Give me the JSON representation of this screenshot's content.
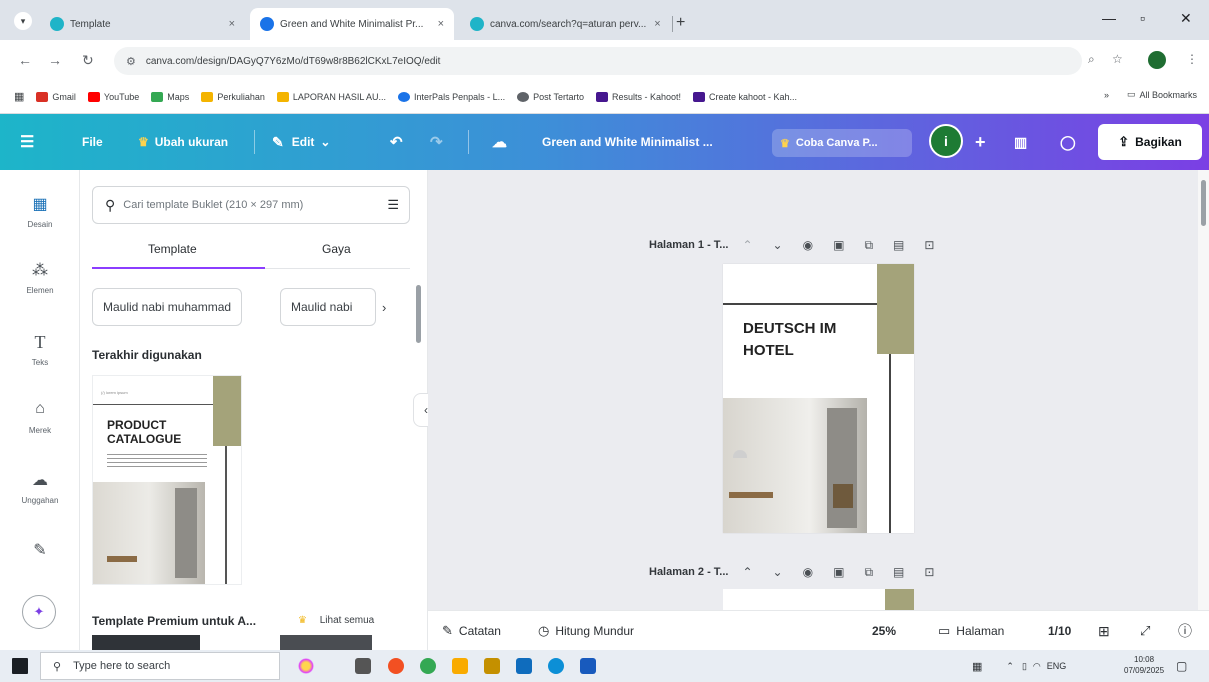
{
  "browser": {
    "tabs": [
      {
        "label": "Template",
        "close": "×"
      },
      {
        "label": "Green and White Minimalist Pr...",
        "close": "×"
      },
      {
        "label": "canva.com/search?q=aturan perv...",
        "close": "×"
      }
    ],
    "new_tab": "+",
    "address": "canva.com/design/DAGyQ7Y6zMo/dT69w8r8B62lCKxL7eIOQ/edit",
    "bookmarks": [
      {
        "label": "Gmail",
        "color": "#d93025"
      },
      {
        "label": "YouTube",
        "color": "#ff0000"
      },
      {
        "label": "Maps",
        "color": "#34a853"
      },
      {
        "label": "Perkuliahan",
        "color": "#f4b400"
      },
      {
        "label": "LAPORAN HASIL AU...",
        "color": "#f4b400"
      },
      {
        "label": "InterPals Penpals - L...",
        "color": "#1a73e8"
      },
      {
        "label": "Post Tertarto",
        "color": "#5f6368"
      },
      {
        "label": "Results - Kahoot!",
        "color": "#46178f"
      },
      {
        "label": "Create kahoot - Kah...",
        "color": "#46178f"
      }
    ],
    "bookmarks_more": "»",
    "all_bookmarks": "All Bookmarks"
  },
  "canva_header": {
    "file": "File",
    "resize": "Ubah ukuran",
    "edit": "Edit",
    "doc_title": "Green and White Minimalist ...",
    "try_pro": "Coba Canva P...",
    "avatar_initial": "i",
    "share": "Bagikan",
    "plus": "+"
  },
  "rail": [
    {
      "label": "Desain",
      "icon": "design-icon"
    },
    {
      "label": "Elemen",
      "icon": "elements-icon"
    },
    {
      "label": "Teks",
      "icon": "text-icon"
    },
    {
      "label": "Merek",
      "icon": "brand-icon"
    },
    {
      "label": "Unggahan",
      "icon": "upload-icon"
    },
    {
      "label": "",
      "icon": "draw-icon"
    }
  ],
  "panel": {
    "search_placeholder": "Cari template Buklet (210 × 297 mm)",
    "tabs": [
      "Template",
      "Gaya"
    ],
    "chips": [
      "Maulid nabi muhammad",
      "Maulid nabi"
    ],
    "recent_title": "Terakhir digunakan",
    "premium_title": "Template Premium untuk A...",
    "see_all": "Lihat semua",
    "thumb_title_line1": "PRODUCT",
    "thumb_title_line2": "CATALOGUE",
    "thumb_tiny": "(/) lorem ipsum"
  },
  "canvas": {
    "page1_label": "Halaman 1 - T...",
    "page2_label": "Halaman 2 - T...",
    "page1_title_line1": "DEUTSCH IM",
    "page1_title_line2": "HOTEL",
    "accent_color": "#a4a37a"
  },
  "statusbar": {
    "notes": "Catatan",
    "timer": "Hitung Mundur",
    "zoom": "25%",
    "pages": "Halaman",
    "page_count": "1/10"
  },
  "taskbar": {
    "search_placeholder": "Type here to search",
    "lang": "ENG",
    "time": "10:08",
    "date": "07/09/2025"
  }
}
